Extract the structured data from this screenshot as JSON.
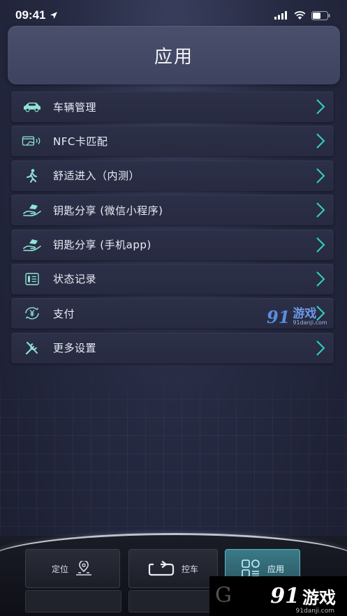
{
  "status_bar": {
    "time": "09:41"
  },
  "header": {
    "title": "应用"
  },
  "menu": [
    {
      "label": "车辆管理",
      "icon": "car-icon"
    },
    {
      "label": "NFC卡匹配",
      "icon": "nfc-card-icon"
    },
    {
      "label": "舒适进入（内测）",
      "icon": "walking-person-icon"
    },
    {
      "label": "钥匙分享 (微信小程序)",
      "icon": "key-share-hand-icon"
    },
    {
      "label": "钥匙分享 (手机app)",
      "icon": "key-share-hand-icon"
    },
    {
      "label": "状态记录",
      "icon": "record-list-icon"
    },
    {
      "label": "支付",
      "icon": "yuan-coin-icon"
    },
    {
      "label": "更多设置",
      "icon": "tools-icon"
    }
  ],
  "tabs": {
    "locate": {
      "label": "定位",
      "icon": "location-pin-icon"
    },
    "control": {
      "label": "控车",
      "icon": "loop-arrow-icon"
    },
    "apps": {
      "label": "应用",
      "icon": "apps-grid-icon",
      "active": true
    }
  },
  "watermarks": {
    "brand_number": "91",
    "brand_text": "游戏",
    "url": "91danji.com"
  },
  "colors": {
    "accent": "#2fd3c2",
    "icon": "#8fe3d6",
    "tab_active": "#3b7a88"
  }
}
